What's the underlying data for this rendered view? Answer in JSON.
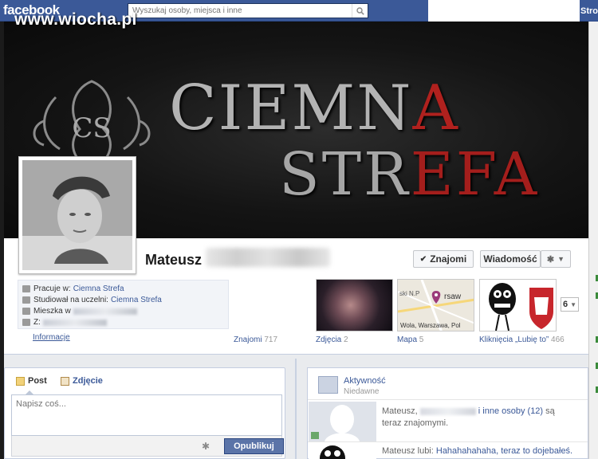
{
  "topbar": {
    "logo": "facebook",
    "search_placeholder": "Wyszukaj osoby, miejsca i inne",
    "nav_right": "Strona"
  },
  "watermark": "www.wiocha.pl",
  "cover": {
    "line1_a": "CIEMN",
    "line1_b": "A",
    "line2_a": "STR",
    "line2_b": "EFA"
  },
  "profile": {
    "name": "Mateusz",
    "buttons": {
      "friends": "Znajomi",
      "message": "Wiadomość"
    }
  },
  "about": {
    "rows": [
      {
        "label": "Pracuje w:",
        "value": "Ciemna Strefa",
        "icon": "briefcase-icon"
      },
      {
        "label": "Studiował na uczelni:",
        "value": "Ciemna Strefa",
        "icon": "graduation-icon"
      },
      {
        "label": "Mieszka w",
        "value": "",
        "icon": "home-icon"
      },
      {
        "label": "Z:",
        "value": "",
        "icon": "pin-icon"
      }
    ],
    "info_link": "Informacje"
  },
  "apps": [
    {
      "label": "Znajomi",
      "count": "717"
    },
    {
      "label": "Zdjęcia",
      "count": "2"
    },
    {
      "label": "Mapa",
      "count": "5"
    },
    {
      "label": "Kliknięcia „Lubię to”",
      "count": "466"
    }
  ],
  "map_labels": {
    "a": "ski N.P",
    "b": "rsaw",
    "c": "Wola, Warszawa, Pol"
  },
  "more_apps": "6",
  "composer": {
    "tab_post": "Post",
    "tab_photo": "Zdjęcie",
    "placeholder": "Napisz coś...",
    "publish": "Opublikuj"
  },
  "activity": {
    "title": "Aktywność",
    "subtitle": "Niedawne",
    "item1_prefix": "Mateusz,",
    "item1_link": "i inne osoby (12)",
    "item1_suffix": "są teraz znajomymi.",
    "item2_prefix": "Mateusz lubi:",
    "item2_link": "Hahahahahaha, teraz to dojebałeś."
  }
}
